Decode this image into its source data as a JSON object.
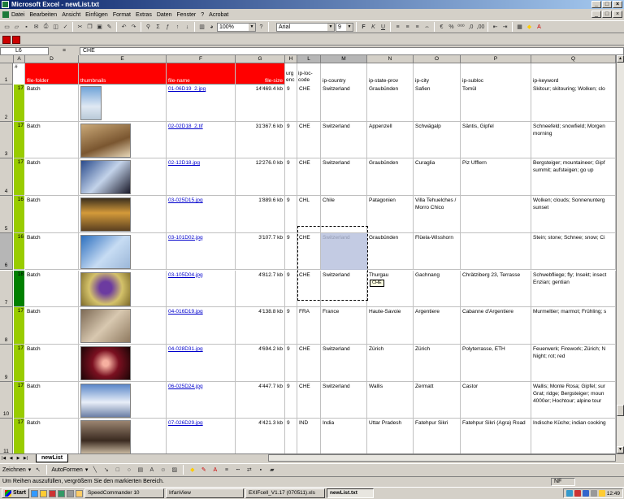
{
  "window": {
    "title": "Microsoft Excel - newList.txt",
    "controls": [
      "_",
      "□",
      "×"
    ]
  },
  "menu": [
    "Datei",
    "Bearbeiten",
    "Ansicht",
    "Einfügen",
    "Format",
    "Extras",
    "Daten",
    "Fenster",
    "?",
    "Acrobat"
  ],
  "toolbar": {
    "zoom": "100%",
    "font": "Arial",
    "size": "9"
  },
  "formula_bar": {
    "name_box": "L6",
    "fx": "=",
    "content": "CHE"
  },
  "columns": [
    "A",
    "D",
    "E",
    "F",
    "G",
    "H",
    "L",
    "M",
    "N",
    "O",
    "P",
    "Q"
  ],
  "header_row": {
    "a": "#",
    "folder": "file-folder",
    "thumb": "thumbnails",
    "name": "file-name",
    "size": "file-size",
    "urg": "urg enc",
    "loc": "ip-loc-code",
    "country": "ip-country",
    "state": "ip-state-prov",
    "city": "ip-city",
    "subloc": "ip-subloc",
    "keyword": "ip-keyword"
  },
  "rows": [
    {
      "n": "2",
      "num": "17",
      "folder": "Batch",
      "file": "01-06D19_2.jpg",
      "size": "14'469.4 kb",
      "urg": "9",
      "loc": "CHE",
      "country": "Switzerland",
      "state": "Graubünden",
      "city": "Safien",
      "subloc": "Tomül",
      "kw": "Skitour; skitouring; Wolken; clo"
    },
    {
      "n": "3",
      "num": "17",
      "folder": "Batch",
      "file": "02-02D18_2.tif",
      "size": "31'367.6 kb",
      "urg": "9",
      "loc": "CHE",
      "country": "Switzerland",
      "state": "Appenzell",
      "city": "Schwägalp",
      "subloc": "Säntis, Gipfel",
      "kw": "Schneefeld; snowfield; Morgen morning"
    },
    {
      "n": "4",
      "num": "17",
      "folder": "Batch",
      "file": "02-12D18.jpg",
      "size": "12'276.0 kb",
      "urg": "9",
      "loc": "CHE",
      "country": "Switzerland",
      "state": "Graubünden",
      "city": "Curaglia",
      "subloc": "Piz Ufflern",
      "kw": "Bergsteiger; mountaineer; Gipf summit; aufsteigen; go up"
    },
    {
      "n": "5",
      "num": "16",
      "folder": "Batch",
      "file": "03-025D15.jpg",
      "size": "1'889.6 kb",
      "urg": "9",
      "loc": "CHL",
      "country": "Chile",
      "state": "Patagonien",
      "city": "Villa Tehuelches / Morro Chico",
      "subloc": "",
      "kw": "Wolken; clouds; Sonnenunterg sunset"
    },
    {
      "n": "6",
      "num": "16",
      "folder": "Batch",
      "file": "03-101D02.jpg",
      "size": "3'107.7 kb",
      "urg": "9",
      "loc": "CHE",
      "country": "Switzerland",
      "state": "Graubünden",
      "city": "Flüela-Wisshorn",
      "subloc": "",
      "kw": "Stein; stone; Schnee; snow; Ci"
    },
    {
      "n": "7",
      "num": "18",
      "folder": "Batch",
      "file": "03-105D04.jpg",
      "size": "4'812.7 kb",
      "urg": "9",
      "loc": "CHE",
      "country": "Switzerland",
      "state": "Thurgau",
      "city": "Gachnang",
      "subloc": "Chrätziberg 23, Terrasse",
      "kw": "Schwebfliege; fly; Insekt; insect Enzian; gentian"
    },
    {
      "n": "8",
      "num": "17",
      "folder": "Batch",
      "file": "04-016D19.jpg",
      "size": "4'138.8 kb",
      "urg": "9",
      "loc": "FRA",
      "country": "France",
      "state": "Haute-Savoie",
      "city": "Argentiere",
      "subloc": "Cabanne d'Argentiere",
      "kw": "Murmeltier; marmot; Frühling; s"
    },
    {
      "n": "9",
      "num": "17",
      "folder": "Batch",
      "file": "04-028D31.jpg",
      "size": "4'694.2 kb",
      "urg": "9",
      "loc": "CHE",
      "country": "Switzerland",
      "state": "Zürich",
      "city": "Zürich",
      "subloc": "Polyterrasse, ETH",
      "kw": "Feuerwerk; Firework; Zürich; N Night; rot; red"
    },
    {
      "n": "10",
      "num": "17",
      "folder": "Batch",
      "file": "06-025D24.jpg",
      "size": "4'447.7 kb",
      "urg": "9",
      "loc": "CHE",
      "country": "Switzerland",
      "state": "Wallis",
      "city": "Zermatt",
      "subloc": "Castor",
      "kw": "Wallis; Monte Rosa; Gipfel; sur Grat; ridge; Bergsteiger; moun 4000er; Hochtour; alpine tour"
    },
    {
      "n": "11",
      "num": "17",
      "folder": "Batch",
      "file": "07-026D29.jpg",
      "size": "4'421.3 kb",
      "urg": "9",
      "loc": "IND",
      "country": "India",
      "state": "Uttar Pradesh",
      "city": "Fatehpur Sikri",
      "subloc": "Fatehpur Sikri (Agra) Road",
      "kw": "Indische Küche; indian cooking"
    }
  ],
  "row_header_top": "1",
  "tooltip": "CHE",
  "sheet_tab": "newList",
  "drawbar": {
    "draw": "Zeichnen",
    "autoshapes": "AutoFormen"
  },
  "status": {
    "text": "Um Reihen auszufüllen, vergrößern Sie den markierten Bereich.",
    "nf": "NF"
  },
  "taskbar": {
    "start": "Start",
    "tasks": [
      "SpeedCommander 10",
      "IrfanView",
      "EXIFcell_V1.17 (070511).xls",
      "newList.txt"
    ],
    "clock": "12:49"
  }
}
